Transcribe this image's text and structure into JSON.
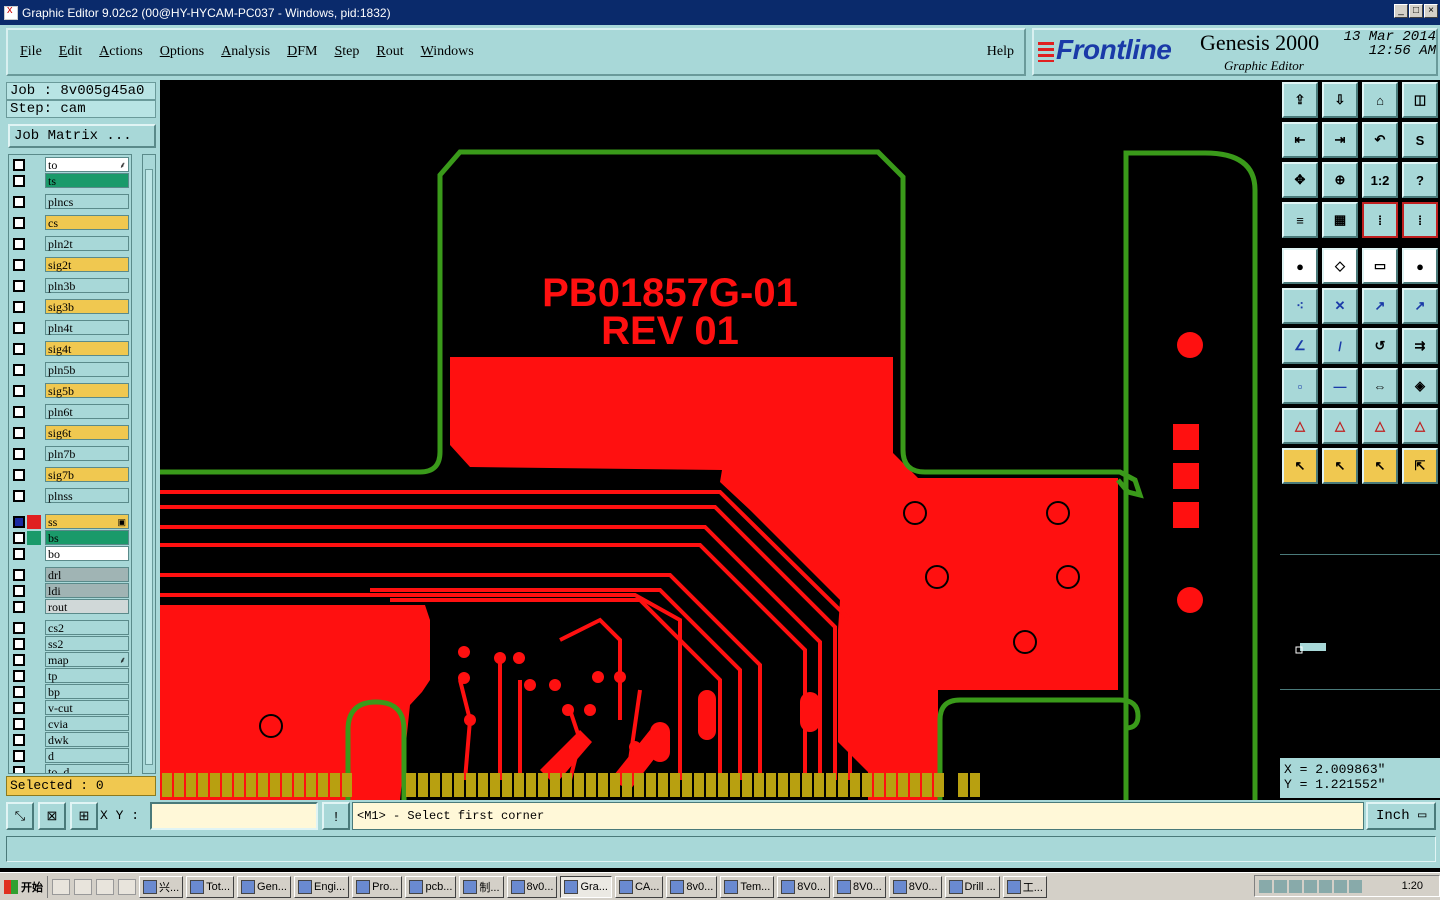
{
  "window": {
    "title": "Graphic Editor 9.02c2 (00@HY-HYCAM-PC037 - Windows, pid:1832)",
    "buttons": [
      "_",
      "□",
      "×"
    ]
  },
  "menu": {
    "items": [
      {
        "label": "File",
        "u": "F"
      },
      {
        "label": "Edit",
        "u": "E"
      },
      {
        "label": "Actions",
        "u": "A"
      },
      {
        "label": "Options",
        "u": "O"
      },
      {
        "label": "Analysis",
        "u": "A"
      },
      {
        "label": "DFM",
        "u": "D"
      },
      {
        "label": "Step",
        "u": "S"
      },
      {
        "label": "Rout",
        "u": "R"
      },
      {
        "label": "Windows",
        "u": "W"
      }
    ],
    "help": "Help"
  },
  "brand": {
    "logo": "Frontline",
    "product": "Genesis 2000",
    "subtitle": "Graphic Editor",
    "date": "13 Mar 2014",
    "time": "12:56 AM"
  },
  "job": {
    "job_line": "Job : 8v005g45a0",
    "step_line": "Step: cam",
    "matrix_button": "Job Matrix ..."
  },
  "layers": [
    {
      "name": "to",
      "bg": "#ffffff",
      "color": "#ffffff",
      "mark": "⸙"
    },
    {
      "name": "ts",
      "bg": "#1a9a6a",
      "color": "#ffffff"
    },
    {
      "name": "plncs",
      "bg": "#a8d8d8",
      "color": "#ffffff"
    },
    {
      "name": "cs",
      "bg": "#f0c850",
      "color": "#ffffff"
    },
    {
      "name": "pln2t",
      "bg": "#a8d8d8",
      "color": "#ffffff"
    },
    {
      "name": "sig2t",
      "bg": "#f0c850",
      "color": "#ffffff"
    },
    {
      "name": "pln3b",
      "bg": "#a8d8d8",
      "color": "#ffffff"
    },
    {
      "name": "sig3b",
      "bg": "#f0c850",
      "color": "#ffffff"
    },
    {
      "name": "pln4t",
      "bg": "#a8d8d8",
      "color": "#ffffff"
    },
    {
      "name": "sig4t",
      "bg": "#f0c850",
      "color": "#ffffff"
    },
    {
      "name": "pln5b",
      "bg": "#a8d8d8",
      "color": "#ffffff"
    },
    {
      "name": "sig5b",
      "bg": "#f0c850",
      "color": "#ffffff"
    },
    {
      "name": "pln6t",
      "bg": "#a8d8d8",
      "color": "#ffffff"
    },
    {
      "name": "sig6t",
      "bg": "#f0c850",
      "color": "#ffffff"
    },
    {
      "name": "pln7b",
      "bg": "#a8d8d8",
      "color": "#ffffff"
    },
    {
      "name": "sig7b",
      "bg": "#f0c850",
      "color": "#ffffff"
    },
    {
      "name": "plnss",
      "bg": "#a8d8d8",
      "color": "#ffffff"
    },
    {
      "name": "ss",
      "bg": "#f0c850",
      "color": "#e02020",
      "mark": "▣"
    },
    {
      "name": "bs",
      "bg": "#1a9a6a",
      "color": "#1a9a6a"
    },
    {
      "name": "bo",
      "bg": "#ffffff",
      "color": "#ffffff"
    },
    {
      "name": "drl",
      "bg": "#a0b4b4",
      "color": "#ffffff"
    },
    {
      "name": "ldi",
      "bg": "#a0b4b4",
      "color": "#ffffff"
    },
    {
      "name": "rout",
      "bg": "#d0d8d8",
      "color": "#ffffff"
    },
    {
      "name": "cs2",
      "bg": "#a8d8d8",
      "color": "#ffffff"
    },
    {
      "name": "ss2",
      "bg": "#a8d8d8",
      "color": "#ffffff"
    },
    {
      "name": "map",
      "bg": "#a8d8d8",
      "color": "#ffffff",
      "mark": "⸙"
    },
    {
      "name": "tp",
      "bg": "#a8d8d8",
      "color": "#ffffff"
    },
    {
      "name": "bp",
      "bg": "#a8d8d8",
      "color": "#ffffff"
    },
    {
      "name": "v-cut",
      "bg": "#a8d8d8",
      "color": "#ffffff"
    },
    {
      "name": "cvia",
      "bg": "#a8d8d8",
      "color": "#ffffff"
    },
    {
      "name": "dwk",
      "bg": "#a8d8d8",
      "color": "#ffffff"
    },
    {
      "name": "d",
      "bg": "#a8d8d8",
      "color": "#ffffff"
    },
    {
      "name": "to_d",
      "bg": "#a8d8d8",
      "color": "#ffffff"
    }
  ],
  "selected": "Selected : 0",
  "canvas": {
    "text_line1": "PB01857G-01",
    "text_line2": "REV 01",
    "colors": {
      "outline": "#3a9a1a",
      "copper": "#ff1010",
      "fingers": "#b8a010",
      "background": "#000000"
    }
  },
  "toolbox": {
    "rows": [
      [
        "⇪",
        "⇩",
        "⌂",
        "◫"
      ],
      [
        "⇤",
        "⇥",
        "↶",
        "S"
      ],
      [
        "✥",
        "⊕",
        "1:2",
        "?"
      ],
      [
        "≡",
        "▦",
        "⁞",
        "⁞"
      ],
      [
        "●",
        "◇",
        "▭",
        "●"
      ],
      [
        "⁖",
        "✕",
        "↗",
        "↗"
      ],
      [
        "∠",
        "/",
        "↺",
        "⇉"
      ],
      [
        "▫",
        "—",
        "⇔",
        "◈"
      ],
      [
        "△",
        "△",
        "△",
        "△"
      ],
      [
        "↖",
        "↖",
        "↖",
        "⇱"
      ]
    ],
    "styles": [
      [
        "",
        "",
        "",
        ""
      ],
      [
        "",
        "",
        "",
        ""
      ],
      [
        "",
        "",
        "",
        ""
      ],
      [
        "",
        "",
        "redbox",
        "redbox"
      ],
      [
        "white",
        "white",
        "white",
        "white"
      ],
      [
        "",
        "",
        "",
        ""
      ],
      [
        "",
        "",
        "",
        ""
      ],
      [
        "",
        "",
        "",
        ""
      ],
      [
        "",
        "",
        "",
        ""
      ],
      [
        "orange",
        "orange",
        "orange",
        "orange"
      ]
    ]
  },
  "coords": {
    "x": "X = 2.009863\"",
    "y": "Y = 1.221552\""
  },
  "status": {
    "xy_label": "X Y :",
    "xy_value": "",
    "prompt": "<M1> - Select first corner",
    "unit": "Inch",
    "bang": "!"
  },
  "taskbar": {
    "start": "开始",
    "tasks": [
      {
        "label": "兴..."
      },
      {
        "label": "Tot..."
      },
      {
        "label": "Gen..."
      },
      {
        "label": "Engi..."
      },
      {
        "label": "Pro..."
      },
      {
        "label": "pcb..."
      },
      {
        "label": "制..."
      },
      {
        "label": "8v0..."
      },
      {
        "label": "Gra...",
        "active": true
      },
      {
        "label": "CA..."
      },
      {
        "label": "8v0..."
      },
      {
        "label": "Tem..."
      },
      {
        "label": "8V0..."
      },
      {
        "label": "8V0..."
      },
      {
        "label": "8V0..."
      },
      {
        "label": "Drill ..."
      },
      {
        "label": "工..."
      }
    ],
    "clock": "1:20"
  }
}
